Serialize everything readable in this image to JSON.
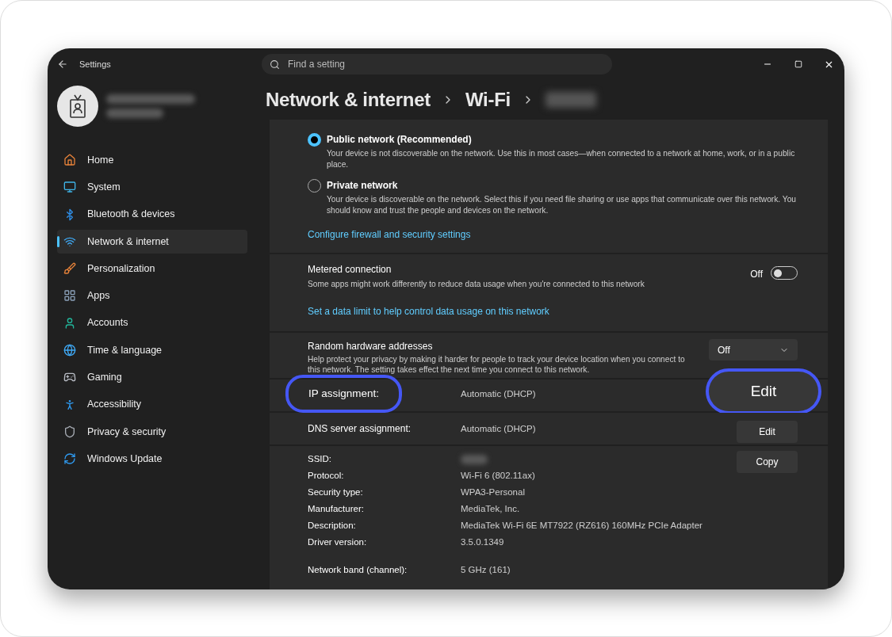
{
  "window": {
    "title": "Settings"
  },
  "search": {
    "placeholder": "Find a setting"
  },
  "nav": [
    {
      "label": "Home",
      "selected": false
    },
    {
      "label": "System",
      "selected": false
    },
    {
      "label": "Bluetooth & devices",
      "selected": false
    },
    {
      "label": "Network & internet",
      "selected": true
    },
    {
      "label": "Personalization",
      "selected": false
    },
    {
      "label": "Apps",
      "selected": false
    },
    {
      "label": "Accounts",
      "selected": false
    },
    {
      "label": "Time & language",
      "selected": false
    },
    {
      "label": "Gaming",
      "selected": false
    },
    {
      "label": "Accessibility",
      "selected": false
    },
    {
      "label": "Privacy & security",
      "selected": false
    },
    {
      "label": "Windows Update",
      "selected": false
    }
  ],
  "breadcrumb": {
    "items": [
      "Network & internet",
      "Wi-Fi"
    ]
  },
  "network_profile": {
    "options": [
      {
        "label": "Public network (Recommended)",
        "description": "Your device is not discoverable on the network. Use this in most cases—when connected to a network at home, work, or in a public place.",
        "selected": true
      },
      {
        "label": "Private network",
        "description": "Your device is discoverable on the network. Select this if you need file sharing or use apps that communicate over this network. You should know and trust the people and devices on the network.",
        "selected": false
      }
    ],
    "link": "Configure firewall and security settings"
  },
  "metered": {
    "title": "Metered connection",
    "description": "Some apps might work differently to reduce data usage when you're connected to this network",
    "toggle": {
      "label": "Off",
      "on": false
    },
    "link": "Set a data limit to help control data usage on this network"
  },
  "random_hardware": {
    "title": "Random hardware addresses",
    "description": "Help protect your privacy by making it harder for people to track your device location when you connect to this network. The setting takes effect the next time you connect to this network.",
    "dropdown": {
      "value": "Off"
    }
  },
  "assignments": [
    {
      "label": "IP assignment:",
      "value": "Automatic (DHCP)",
      "button": "Edit",
      "highlighted": true
    },
    {
      "label": "DNS server assignment:",
      "value": "Automatic (DHCP)",
      "button": "Edit",
      "highlighted": false
    }
  ],
  "properties": {
    "copy_button": "Copy",
    "groups": [
      [
        {
          "label": "SSID:"
        },
        {
          "label": "Protocol:",
          "value": "Wi-Fi 6 (802.11ax)"
        },
        {
          "label": "Security type:",
          "value": "WPA3-Personal"
        },
        {
          "label": "Manufacturer:",
          "value": "MediaTek, Inc."
        },
        {
          "label": "Description:",
          "value": "MediaTek Wi-Fi 6E MT7922 (RZ616) 160MHz PCIe Adapter"
        },
        {
          "label": "Driver version:",
          "value": "3.5.0.1349"
        }
      ],
      [
        {
          "label": "Network band (channel):",
          "value": "5 GHz (161)"
        }
      ]
    ]
  }
}
